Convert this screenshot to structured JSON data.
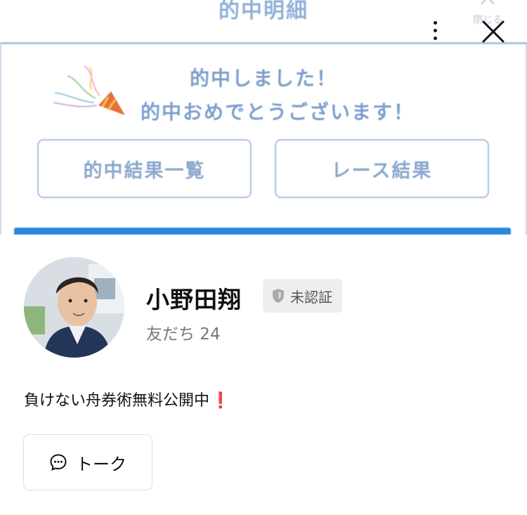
{
  "cover": {
    "title": "的中明細",
    "close_hint": "閉じる",
    "message_line1": "的中しました！",
    "message_line2": "的中おめでとうございます！",
    "button_hit_list": "的中結果一覧",
    "button_race_results": "レース結果",
    "accent_color": "#2c86de"
  },
  "controls": {
    "more_icon": "kebab-vertical-icon",
    "close_icon": "close-icon"
  },
  "profile": {
    "name": "小野田翔",
    "verification_badge": "未認証",
    "friends_text": "友だち 24",
    "status_message": "負けない舟券術無料公開中",
    "status_emoji": "❗"
  },
  "actions": {
    "talk_label": "トーク",
    "talk_icon": "chat-bubble-icon"
  }
}
